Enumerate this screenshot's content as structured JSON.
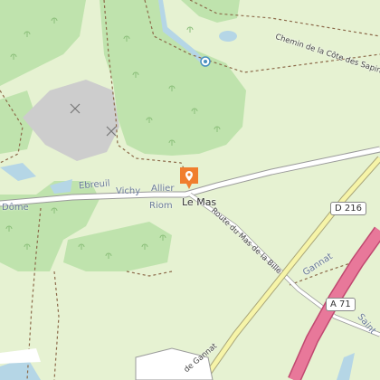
{
  "map": {
    "colors": {
      "background": "#e6f2d2",
      "forest": "#bfe3ad",
      "quarry": "#cdcdcd",
      "water": "#b5d6e6",
      "road": "#ffffff",
      "main_road": "#f6f4a8",
      "motorway": "#e8789a",
      "marker": "#f07e2e"
    },
    "labels": {
      "village": "Le Mas",
      "direction_ebreuil": "Ebreuil",
      "direction_vichy": "Vichy",
      "direction_allier": "Allier",
      "direction_riom": "Riom",
      "direction_dome": "Dôme",
      "direction_gannat": "Gannat",
      "direction_saint": "Saint",
      "road_chemin_cote_sapins": "Chemin de la Côte des Sapins",
      "road_route_mas_bille": "Route du Mas de la Bille",
      "road_de_gannat": "de Gannat"
    },
    "shields": {
      "d216": "D 216",
      "a71": "A 71"
    },
    "icons": {
      "marker": "location-pin-icon",
      "quarry_symbols": "quarry-icon",
      "spring": "spring-icon"
    }
  }
}
